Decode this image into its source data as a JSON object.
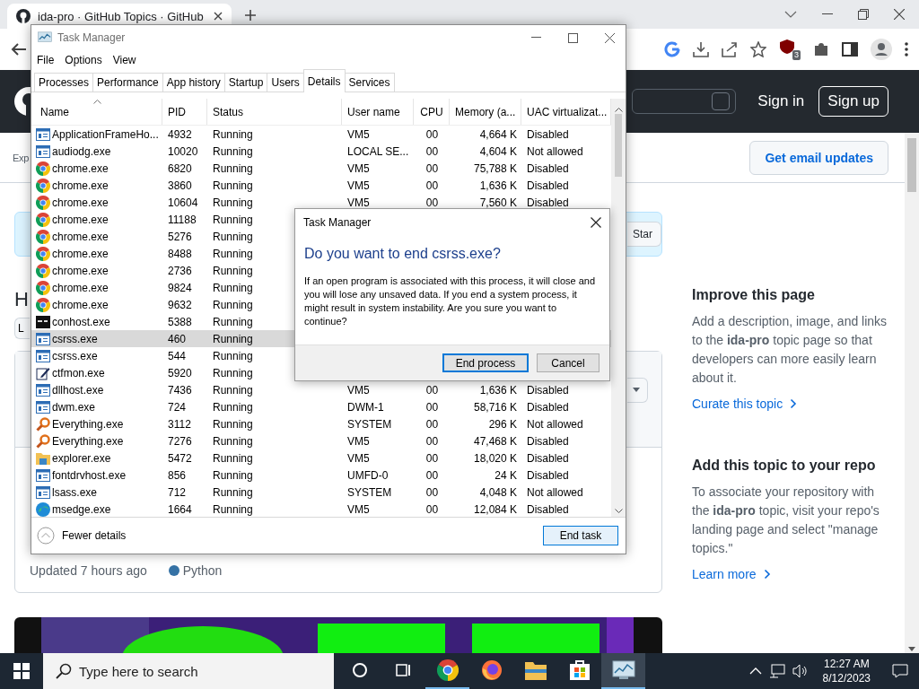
{
  "browser": {
    "tab_title": "ida-pro · GitHub Topics · GitHub",
    "extension_badge": "3"
  },
  "github": {
    "sign_in": "Sign in",
    "sign_up": "Sign up",
    "explore_fragment": "Exp",
    "email_button": "Get email updates",
    "star_button": "Star",
    "heading_fragment": "H",
    "button_fragment": "L",
    "repo_card": {
      "updated": "Updated 7 hours ago",
      "language": {
        "name": "Python",
        "color": "#3572a5"
      }
    },
    "sidebar": [
      {
        "title": "Improve this page",
        "body": "Add a description, image, and links to the **ida-pro** topic page so that developers can more easily learn about it.",
        "link": "Curate this topic"
      },
      {
        "title": "Add this topic to your repo",
        "body": "To associate your repository with the **ida-pro** topic, visit your repo's landing page and select \"manage topics.\"",
        "link": "Learn more"
      }
    ]
  },
  "task_manager": {
    "title": "Task Manager",
    "menu": [
      "File",
      "Options",
      "View"
    ],
    "tabs": [
      {
        "label": "Processes",
        "selected": false
      },
      {
        "label": "Performance",
        "selected": false
      },
      {
        "label": "App history",
        "selected": false
      },
      {
        "label": "Startup",
        "selected": false
      },
      {
        "label": "Users",
        "selected": false
      },
      {
        "label": "Details",
        "selected": true
      },
      {
        "label": "Services",
        "selected": false
      }
    ],
    "columns": [
      {
        "label": "Name",
        "sorted": true
      },
      {
        "label": "PID",
        "sorted": false
      },
      {
        "label": "Status",
        "sorted": false
      },
      {
        "label": "User name",
        "sorted": false
      },
      {
        "label": "CPU",
        "sorted": false
      },
      {
        "label": "Memory (a...",
        "sorted": false
      },
      {
        "label": "UAC virtualizat...",
        "sorted": false
      }
    ],
    "rows": [
      {
        "kind": "window",
        "name": "ApplicationFrameHo...",
        "pid": "4932",
        "status": "Running",
        "user": "VM5",
        "cpu": "00",
        "memory": "4,664 K",
        "uac": "Disabled",
        "selected": false
      },
      {
        "kind": "window",
        "name": "audiodg.exe",
        "pid": "10020",
        "status": "Running",
        "user": "LOCAL SE...",
        "cpu": "00",
        "memory": "4,604 K",
        "uac": "Not allowed",
        "selected": false
      },
      {
        "kind": "chrome",
        "name": "chrome.exe",
        "pid": "6820",
        "status": "Running",
        "user": "VM5",
        "cpu": "00",
        "memory": "75,788 K",
        "uac": "Disabled",
        "selected": false
      },
      {
        "kind": "chrome",
        "name": "chrome.exe",
        "pid": "3860",
        "status": "Running",
        "user": "VM5",
        "cpu": "00",
        "memory": "1,636 K",
        "uac": "Disabled",
        "selected": false
      },
      {
        "kind": "chrome",
        "name": "chrome.exe",
        "pid": "10604",
        "status": "Running",
        "user": "VM5",
        "cpu": "00",
        "memory": "7,560 K",
        "uac": "Disabled",
        "selected": false
      },
      {
        "kind": "chrome",
        "name": "chrome.exe",
        "pid": "11188",
        "status": "Running",
        "selected": false
      },
      {
        "kind": "chrome",
        "name": "chrome.exe",
        "pid": "5276",
        "status": "Running",
        "selected": false
      },
      {
        "kind": "chrome",
        "name": "chrome.exe",
        "pid": "8488",
        "status": "Running",
        "selected": false
      },
      {
        "kind": "chrome",
        "name": "chrome.exe",
        "pid": "2736",
        "status": "Running",
        "selected": false
      },
      {
        "kind": "chrome",
        "name": "chrome.exe",
        "pid": "9824",
        "status": "Running",
        "selected": false
      },
      {
        "kind": "chrome",
        "name": "chrome.exe",
        "pid": "9632",
        "status": "Running",
        "selected": false
      },
      {
        "kind": "console",
        "name": "conhost.exe",
        "pid": "5388",
        "status": "Running",
        "selected": false
      },
      {
        "kind": "window",
        "name": "csrss.exe",
        "pid": "460",
        "status": "Running",
        "selected": true
      },
      {
        "kind": "window",
        "name": "csrss.exe",
        "pid": "544",
        "status": "Running",
        "selected": false
      },
      {
        "kind": "pen",
        "name": "ctfmon.exe",
        "pid": "5920",
        "status": "Running",
        "selected": false
      },
      {
        "kind": "window",
        "name": "dllhost.exe",
        "pid": "7436",
        "status": "Running",
        "user": "VM5",
        "cpu": "00",
        "memory": "1,636 K",
        "uac": "Disabled",
        "selected": false
      },
      {
        "kind": "window",
        "name": "dwm.exe",
        "pid": "724",
        "status": "Running",
        "user": "DWM-1",
        "cpu": "00",
        "memory": "58,716 K",
        "uac": "Disabled",
        "selected": false
      },
      {
        "kind": "magnifier",
        "name": "Everything.exe",
        "pid": "3112",
        "status": "Running",
        "user": "SYSTEM",
        "cpu": "00",
        "memory": "296 K",
        "uac": "Not allowed",
        "selected": false
      },
      {
        "kind": "magnifier",
        "name": "Everything.exe",
        "pid": "7276",
        "status": "Running",
        "user": "VM5",
        "cpu": "00",
        "memory": "47,468 K",
        "uac": "Disabled",
        "selected": false
      },
      {
        "kind": "folder",
        "name": "explorer.exe",
        "pid": "5472",
        "status": "Running",
        "user": "VM5",
        "cpu": "00",
        "memory": "18,020 K",
        "uac": "Disabled",
        "selected": false
      },
      {
        "kind": "window",
        "name": "fontdrvhost.exe",
        "pid": "856",
        "status": "Running",
        "user": "UMFD-0",
        "cpu": "00",
        "memory": "24 K",
        "uac": "Disabled",
        "selected": false
      },
      {
        "kind": "window",
        "name": "lsass.exe",
        "pid": "712",
        "status": "Running",
        "user": "SYSTEM",
        "cpu": "00",
        "memory": "4,048 K",
        "uac": "Not allowed",
        "selected": false
      },
      {
        "kind": "edge",
        "name": "msedge.exe",
        "pid": "1664",
        "status": "Running",
        "user": "VM5",
        "cpu": "00",
        "memory": "12,084 K",
        "uac": "Disabled",
        "selected": false
      }
    ],
    "fewer_details": "Fewer details",
    "end_task": "End task"
  },
  "dialog": {
    "title": "Task Manager",
    "heading": "Do you want to end csrss.exe?",
    "body": "If an open program is associated with this process, it will close and you will lose any unsaved data. If you end a system process, it might result in system instability. Are you sure you want to continue?",
    "buttons": [
      {
        "label": "End process",
        "default": true
      },
      {
        "label": "Cancel",
        "default": false
      }
    ]
  },
  "taskbar": {
    "search_placeholder": "Type here to search",
    "apps": [
      {
        "kind": "cortana",
        "open": false,
        "selected": false
      },
      {
        "kind": "taskview",
        "open": false,
        "selected": false
      },
      {
        "kind": "chrome",
        "open": true,
        "selected": false
      },
      {
        "kind": "firefox",
        "open": false,
        "selected": false
      },
      {
        "kind": "explorer",
        "open": false,
        "selected": false
      },
      {
        "kind": "store",
        "open": false,
        "selected": false
      },
      {
        "kind": "taskmanager",
        "open": true,
        "selected": true
      }
    ],
    "clock": {
      "time": "12:27 AM",
      "date": "8/12/2023"
    }
  }
}
